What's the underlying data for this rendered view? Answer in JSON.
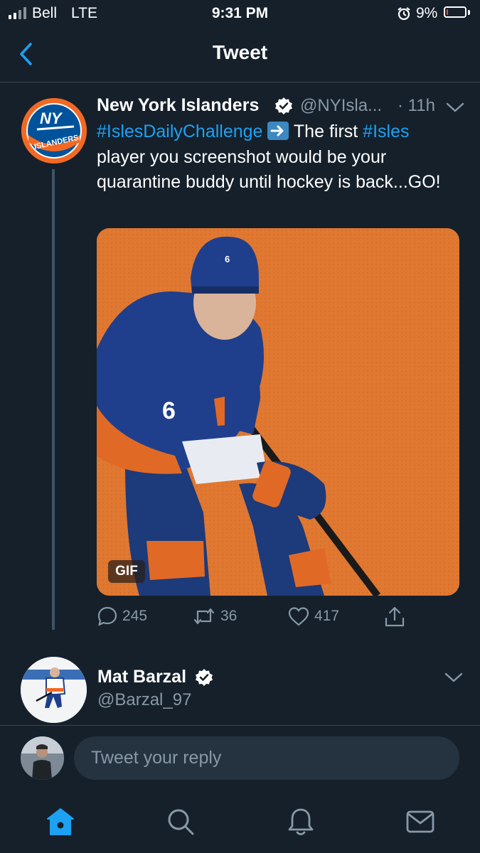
{
  "status_bar": {
    "carrier": "Bell",
    "network": "LTE",
    "time": "9:31 PM",
    "battery": "9%",
    "battery_level": 0.09,
    "icons": [
      "signal-icon",
      "alarm-icon",
      "battery-icon"
    ]
  },
  "header": {
    "title": "Tweet",
    "back_icon": "chevron-left-icon"
  },
  "tweet": {
    "author_name": "New York Islanders",
    "handle": "@NYIsla...",
    "time": "· 11h",
    "body": {
      "hashtag1": "#IslesDailyChallenge",
      "text1": " The first ",
      "hashtag2": "#Isles",
      "text2": " player you screenshot would be your quarantine buddy until hockey is back...GO!"
    },
    "media_badge": "GIF",
    "stats": {
      "replies": "245",
      "retweets": "36",
      "likes": "417"
    }
  },
  "reply_tweet": {
    "author_name": "Mat Barzal",
    "handle": "@Barzal_97"
  },
  "composer": {
    "placeholder": "Tweet your reply"
  },
  "tab_bar": [
    "home-icon",
    "search-icon",
    "notifications-icon",
    "messages-icon"
  ],
  "colors": {
    "background": "#15202b",
    "accent": "#1da1f2",
    "muted": "#8899a6",
    "divider": "#38444d",
    "media_orange": "#e07831",
    "jersey_blue": "#1f3f8c"
  }
}
